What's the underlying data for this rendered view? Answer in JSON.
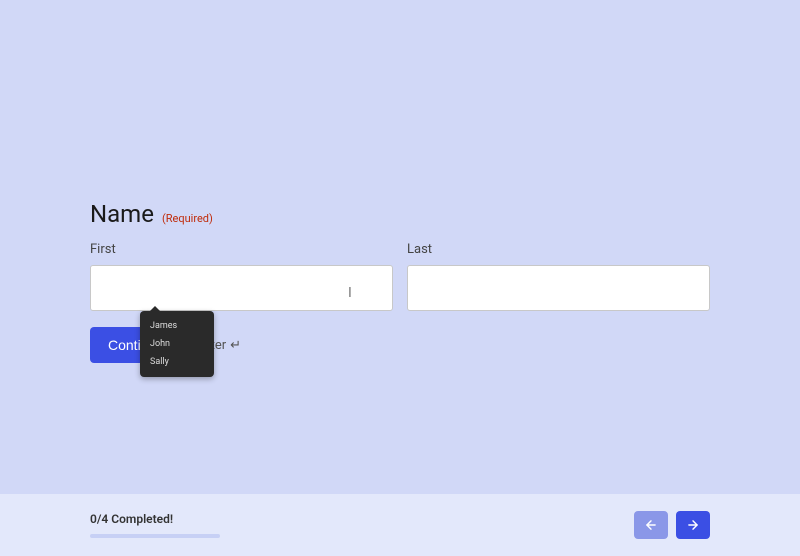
{
  "form": {
    "title": "Name",
    "required_label": "(Required)",
    "first_label": "First",
    "last_label": "Last",
    "first_value": "",
    "last_value": "",
    "continue_label": "Continue",
    "hint_prefix": "Enter",
    "hint_glyph": "↵"
  },
  "autocomplete": {
    "items": [
      "James",
      "John",
      "Sally"
    ]
  },
  "footer": {
    "progress_text": "0/4 Completed!"
  },
  "colors": {
    "primary": "#3b4fe4",
    "bg": "#d1d8f7",
    "footer_bg": "#e3e8fb",
    "required": "#c02b0a"
  }
}
